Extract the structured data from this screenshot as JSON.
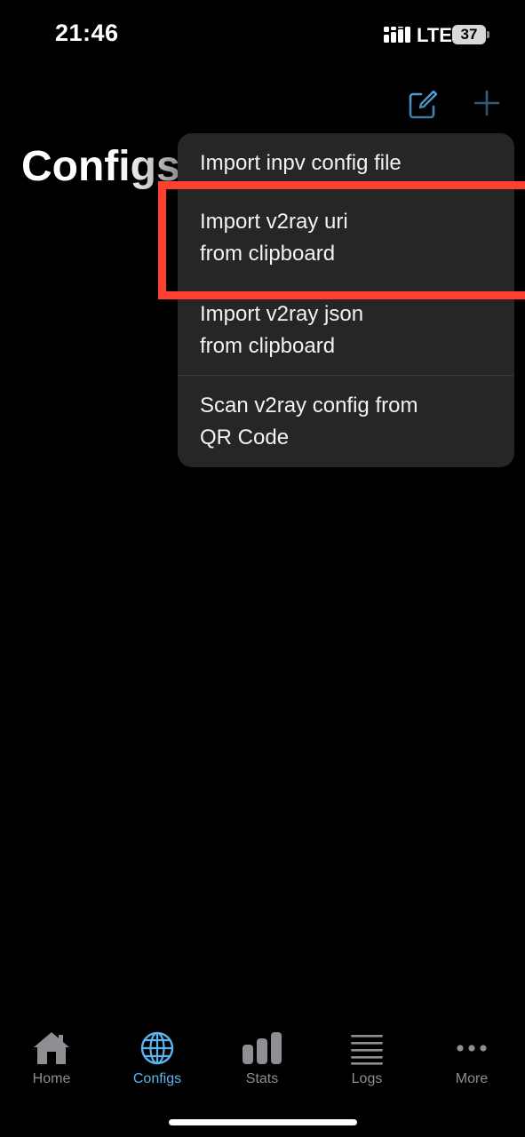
{
  "status_bar": {
    "time": "21:46",
    "network": "LTE",
    "battery": "37",
    "signal_icon": "signal-bars-icon"
  },
  "nav": {
    "title": "Configs",
    "edit_icon": "compose-icon",
    "add_icon": "plus-icon"
  },
  "menu": {
    "items": [
      {
        "lines": [
          "Import inpv config file"
        ]
      },
      {
        "lines": [
          "Import v2ray uri",
          "from clipboard"
        ]
      },
      {
        "lines": [
          "Import v2ray json",
          "from clipboard"
        ]
      },
      {
        "lines": [
          "Scan v2ray config from",
          "QR Code"
        ]
      }
    ]
  },
  "tab_bar": {
    "tabs": [
      {
        "label": "Home",
        "icon": "house-icon"
      },
      {
        "label": "Configs",
        "icon": "globe-icon",
        "active": true
      },
      {
        "label": "Stats",
        "icon": "bar-chart-icon"
      },
      {
        "label": "Logs",
        "icon": "list-lines-icon"
      },
      {
        "label": "More",
        "icon": "ellipsis-icon"
      }
    ]
  },
  "colors": {
    "accent": "#5AB4F0",
    "highlight_outline": "#FF4030",
    "menu_background": "#262626",
    "inactive_tab": "#8E8E93"
  }
}
